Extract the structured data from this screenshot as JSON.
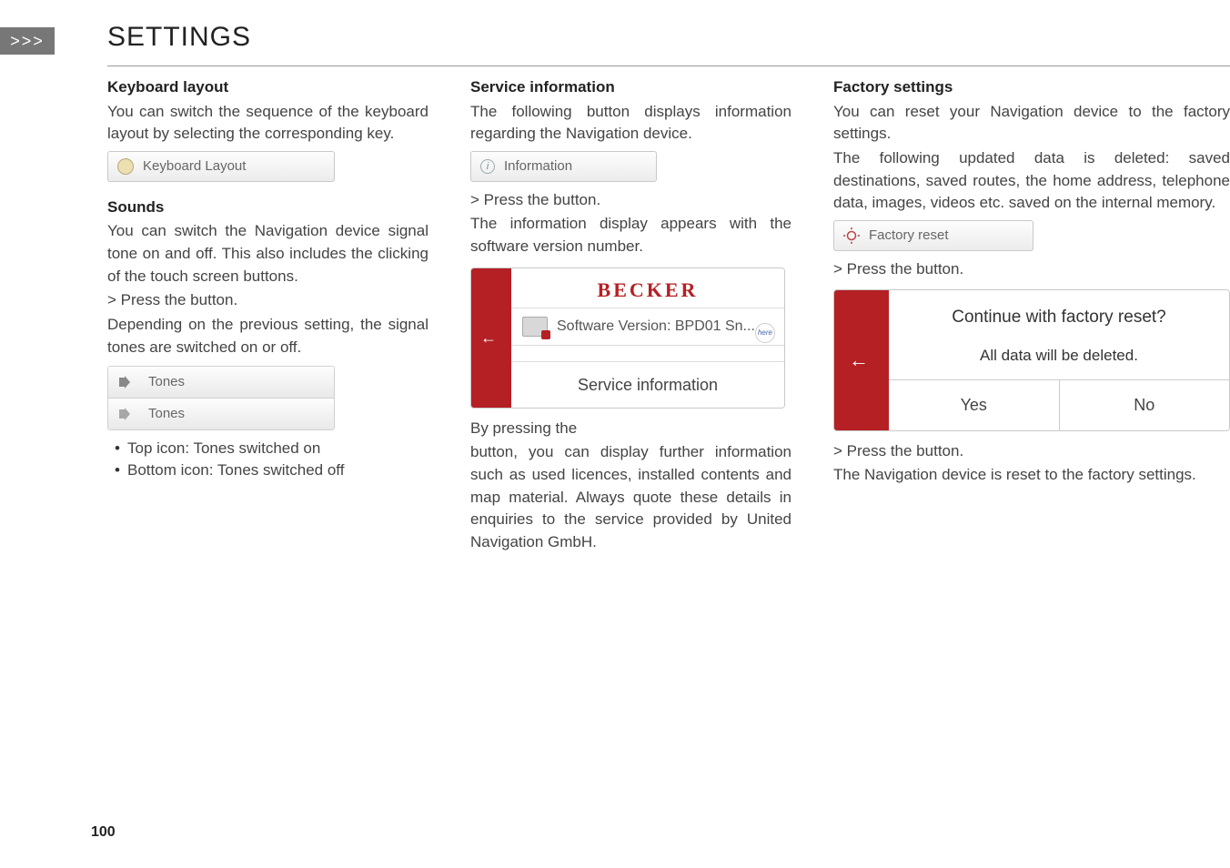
{
  "header": {
    "chevrons": ">>>",
    "title": "SETTINGS"
  },
  "page_number": "100",
  "col1": {
    "kb_heading": "Keyboard layout",
    "kb_text": "You can switch the sequence of the keyboard layout by selecting the corresponding key.",
    "kb_button": "Keyboard Layout",
    "snd_heading": "Sounds",
    "snd_text": "You can switch the Navigation device signal tone on and off. This also includes the clicking of the touch screen buttons.",
    "snd_step": "> Press the          button.",
    "snd_text2": "Depending on the previous setting, the signal tones are switched on or off.",
    "tones_on": "Tones",
    "tones_off": "Tones",
    "bullet1": "Top icon: Tones switched on",
    "bullet2": "Bottom icon: Tones switched off"
  },
  "col2": {
    "si_heading": "Service information",
    "si_text": "The following button displays information regarding the Navigation device.",
    "info_button": "Information",
    "step1": "> Press the                 button.",
    "text2": "The information display appears with the software version number.",
    "becker": "BECKER",
    "sv_row": "Software Version: BPD01 Sn...",
    "here_label": "here",
    "svc_footer": "Service information",
    "text3_line1": "By pressing the",
    "text3_rest": "button, you can display further information such as used licences, installed contents and map material. Always quote these details in enquiries to the service provided by United Navigation GmbH."
  },
  "col3": {
    "fs_heading": "Factory settings",
    "fs_text1": "You can reset your Navigation device to the factory settings.",
    "fs_text2": "The following updated data is deleted: saved destinations, saved routes, the home address, telephone data, images, videos etc. saved on the internal memory.",
    "fr_button": "Factory reset",
    "step1": "> Press the                      button.",
    "dialog_q": "Continue with factory reset?",
    "dialog_msg": "All data will be deleted.",
    "yes": "Yes",
    "no": "No",
    "step2": "> Press the       button.",
    "text3": "The Navigation device is reset to the factory settings."
  }
}
